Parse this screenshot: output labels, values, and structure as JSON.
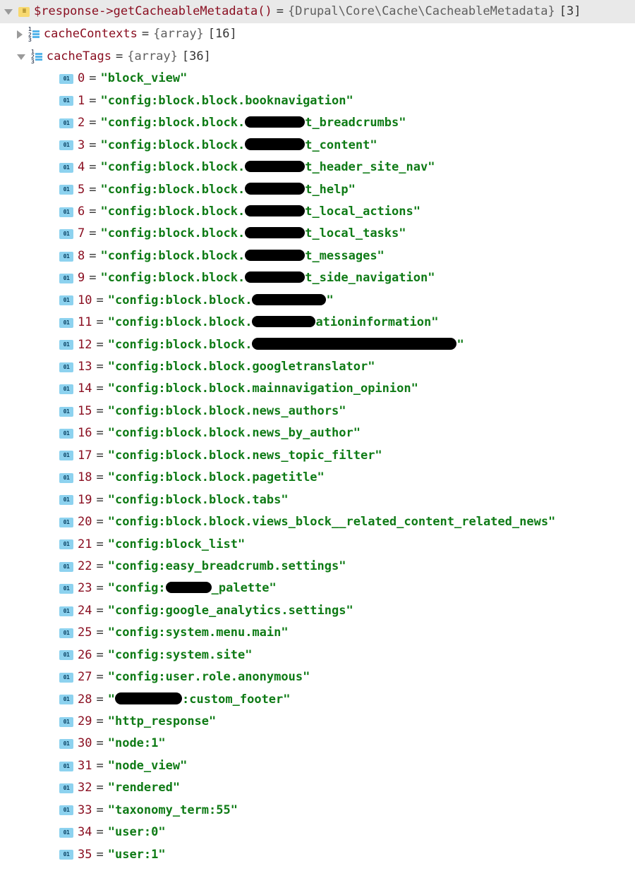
{
  "root": {
    "expr": "$response->getCacheableMetadata()",
    "eq": "=",
    "type": "{Drupal\\Core\\Cache\\CacheableMetadata}",
    "count": "[3]"
  },
  "children": [
    {
      "prop": "cacheContexts",
      "eq": "=",
      "type": "{array}",
      "count": "[16]",
      "expanded": false
    },
    {
      "prop": "cacheTags",
      "eq": "=",
      "type": "{array}",
      "count": "[36]",
      "expanded": true
    }
  ],
  "items": [
    {
      "idx": "0",
      "segments": [
        {
          "t": "\"block_view\""
        }
      ]
    },
    {
      "idx": "1",
      "segments": [
        {
          "t": "\"config:block.block.booknavigation\""
        }
      ]
    },
    {
      "idx": "2",
      "segments": [
        {
          "t": "\"config:block.block."
        },
        {
          "r": 85
        },
        {
          "t": "t_breadcrumbs\""
        }
      ]
    },
    {
      "idx": "3",
      "segments": [
        {
          "t": "\"config:block.block."
        },
        {
          "r": 85
        },
        {
          "t": "t_content\""
        }
      ]
    },
    {
      "idx": "4",
      "segments": [
        {
          "t": "\"config:block.block."
        },
        {
          "r": 85
        },
        {
          "t": "t_header_site_nav\""
        }
      ]
    },
    {
      "idx": "5",
      "segments": [
        {
          "t": "\"config:block.block."
        },
        {
          "r": 85
        },
        {
          "t": "t_help\""
        }
      ]
    },
    {
      "idx": "6",
      "segments": [
        {
          "t": "\"config:block.block."
        },
        {
          "r": 85
        },
        {
          "t": "t_local_actions\""
        }
      ]
    },
    {
      "idx": "7",
      "segments": [
        {
          "t": "\"config:block.block."
        },
        {
          "r": 85
        },
        {
          "t": "t_local_tasks\""
        }
      ]
    },
    {
      "idx": "8",
      "segments": [
        {
          "t": "\"config:block.block."
        },
        {
          "r": 85
        },
        {
          "t": "t_messages\""
        }
      ]
    },
    {
      "idx": "9",
      "segments": [
        {
          "t": "\"config:block.block."
        },
        {
          "r": 85
        },
        {
          "t": "t_side_navigation\""
        }
      ]
    },
    {
      "idx": "10",
      "segments": [
        {
          "t": "\"config:block.block."
        },
        {
          "r": 105
        },
        {
          "t": "\""
        }
      ]
    },
    {
      "idx": "11",
      "segments": [
        {
          "t": "\"config:block.block."
        },
        {
          "r": 90
        },
        {
          "t": "ationinformation\""
        }
      ]
    },
    {
      "idx": "12",
      "segments": [
        {
          "t": "\"config:block.block."
        },
        {
          "r": 290
        },
        {
          "t": "\""
        }
      ]
    },
    {
      "idx": "13",
      "segments": [
        {
          "t": "\"config:block.block.googletranslator\""
        }
      ]
    },
    {
      "idx": "14",
      "segments": [
        {
          "t": "\"config:block.block.mainnavigation_opinion\""
        }
      ]
    },
    {
      "idx": "15",
      "segments": [
        {
          "t": "\"config:block.block.news_authors\""
        }
      ]
    },
    {
      "idx": "16",
      "segments": [
        {
          "t": "\"config:block.block.news_by_author\""
        }
      ]
    },
    {
      "idx": "17",
      "segments": [
        {
          "t": "\"config:block.block.news_topic_filter\""
        }
      ]
    },
    {
      "idx": "18",
      "segments": [
        {
          "t": "\"config:block.block.pagetitle\""
        }
      ]
    },
    {
      "idx": "19",
      "segments": [
        {
          "t": "\"config:block.block.tabs\""
        }
      ]
    },
    {
      "idx": "20",
      "segments": [
        {
          "t": "\"config:block.block.views_block__related_content_related_news\""
        }
      ]
    },
    {
      "idx": "21",
      "segments": [
        {
          "t": "\"config:block_list\""
        }
      ]
    },
    {
      "idx": "22",
      "segments": [
        {
          "t": "\"config:easy_breadcrumb.settings\""
        }
      ]
    },
    {
      "idx": "23",
      "segments": [
        {
          "t": "\"config:"
        },
        {
          "r": 65
        },
        {
          "t": "_palette\""
        }
      ]
    },
    {
      "idx": "24",
      "segments": [
        {
          "t": "\"config:google_analytics.settings\""
        }
      ]
    },
    {
      "idx": "25",
      "segments": [
        {
          "t": "\"config:system.menu.main\""
        }
      ]
    },
    {
      "idx": "26",
      "segments": [
        {
          "t": "\"config:system.site\""
        }
      ]
    },
    {
      "idx": "27",
      "segments": [
        {
          "t": "\"config:user.role.anonymous\""
        }
      ]
    },
    {
      "idx": "28",
      "segments": [
        {
          "t": "\""
        },
        {
          "r": 95
        },
        {
          "t": ":custom_footer\""
        }
      ]
    },
    {
      "idx": "29",
      "segments": [
        {
          "t": "\"http_response\""
        }
      ]
    },
    {
      "idx": "30",
      "segments": [
        {
          "t": "\"node:1\""
        }
      ]
    },
    {
      "idx": "31",
      "segments": [
        {
          "t": "\"node_view\""
        }
      ]
    },
    {
      "idx": "32",
      "segments": [
        {
          "t": "\"rendered\""
        }
      ]
    },
    {
      "idx": "33",
      "segments": [
        {
          "t": "\"taxonomy_term:55\""
        }
      ]
    },
    {
      "idx": "34",
      "segments": [
        {
          "t": "\"user:0\""
        }
      ]
    },
    {
      "idx": "35",
      "segments": [
        {
          "t": "\"user:1\""
        }
      ]
    }
  ]
}
